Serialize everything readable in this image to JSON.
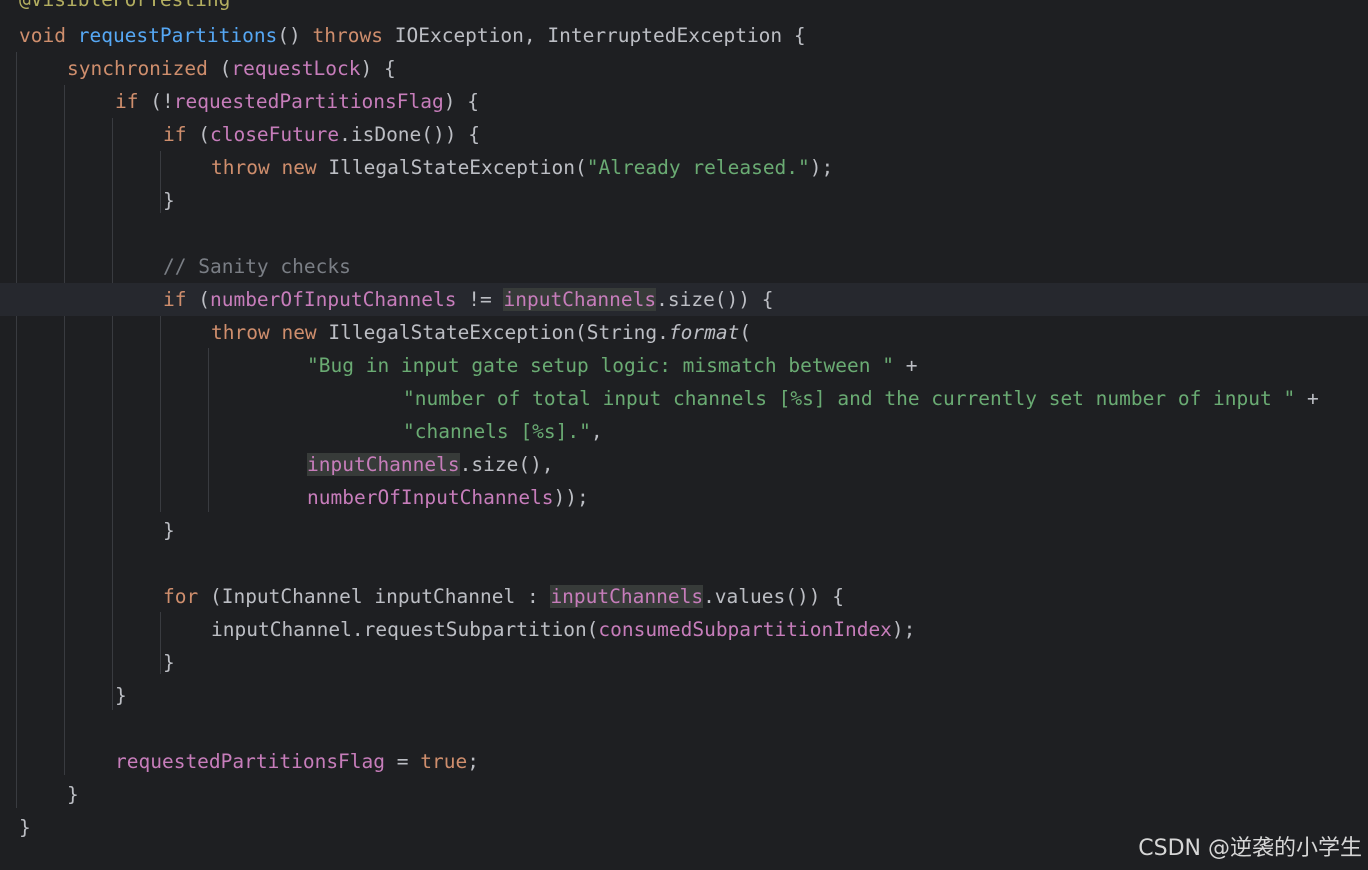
{
  "theme": {
    "background": "#1e1f22",
    "caret_line": "#26282e",
    "keyword": "#cf8e6d",
    "method": "#56a8f5",
    "field": "#c77dbb",
    "string": "#6aab73",
    "comment": "#7a7e85",
    "annotation": "#b3ae60",
    "text": "#bcbec4"
  },
  "code": {
    "line_0": {
      "annotation": "@VisibleForTesting"
    },
    "line_1": {
      "kw_void": "void",
      "method": "requestPartitions",
      "t1": "() ",
      "kw_throws": "throws",
      "t2": " IOException, InterruptedException {"
    },
    "line_2": {
      "kw": "synchronized",
      "t1": " (",
      "field": "requestLock",
      "t2": ") {"
    },
    "line_3": {
      "kw": "if",
      "t1": " (!",
      "field": "requestedPartitionsFlag",
      "t2": ") {"
    },
    "line_4": {
      "kw": "if",
      "t1": " (",
      "field": "closeFuture",
      "t2": ".isDone()) {"
    },
    "line_5": {
      "kw_throw": "throw",
      "kw_new": "new",
      "t1": " IllegalStateException(",
      "str": "\"Already released.\"",
      "t2": ");"
    },
    "line_6": {
      "t": "}"
    },
    "line_8": {
      "comment": "// Sanity checks"
    },
    "line_9": {
      "kw": "if",
      "t1": " (",
      "field1": "numberOfInputChannels",
      "t2": " != ",
      "field2": "inputChannels",
      "t3": ".size()) {"
    },
    "line_10": {
      "kw_throw": "throw",
      "kw_new": "new",
      "t1": " IllegalStateException(String.",
      "italic": "format",
      "t2": "("
    },
    "line_11": {
      "str": "\"Bug in input gate setup logic: mismatch between \"",
      "t": " +"
    },
    "line_12": {
      "str": "\"number of total input channels [%s] and the currently set number of input \"",
      "t": " +"
    },
    "line_13": {
      "str": "\"channels [%s].\"",
      "t": ","
    },
    "line_14": {
      "field": "inputChannels",
      "t": ".size(),"
    },
    "line_15": {
      "field": "numberOfInputChannels",
      "t": "));"
    },
    "line_16": {
      "t": "}"
    },
    "line_18": {
      "kw": "for",
      "t1": " (InputChannel inputChannel : ",
      "field": "inputChannels",
      "t2": ".values()) {"
    },
    "line_19": {
      "t1": "inputChannel.requestSubpartition(",
      "field": "consumedSubpartitionIndex",
      "t2": ");"
    },
    "line_20": {
      "t": "}"
    },
    "line_21": {
      "t": "}"
    },
    "line_23": {
      "field": "requestedPartitionsFlag",
      "t1": " = ",
      "kw": "true",
      "t2": ";"
    },
    "line_24": {
      "t": "}"
    },
    "line_25": {
      "t": "}"
    }
  },
  "watermark": "CSDN @逆袭的小学生"
}
